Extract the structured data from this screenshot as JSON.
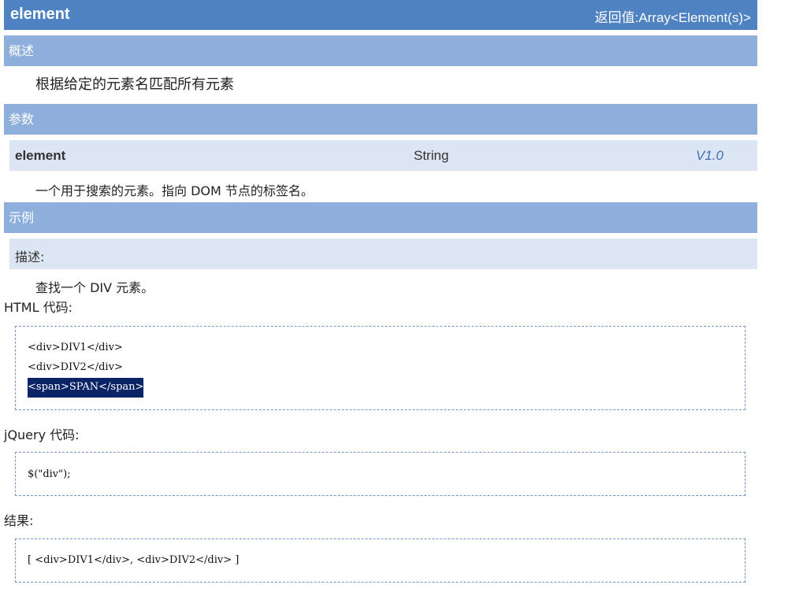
{
  "header": {
    "name": "element",
    "return_value": "返回值:Array<Element(s)>"
  },
  "overview": {
    "heading": "概述",
    "text": "根据给定的元素名匹配所有元素"
  },
  "params": {
    "heading": "参数",
    "name": "element",
    "type": "String",
    "version": "V1.0",
    "description": "一个用于搜索的元素。指向 DOM 节点的标签名。"
  },
  "example": {
    "heading": "示例",
    "desc_label": "描述:",
    "desc_text": "查找一个 DIV 元素。",
    "html_label": "HTML 代码:",
    "html_code": [
      "<div>DIV1</div>",
      "<div>DIV2</div>",
      "<span>SPAN</span>"
    ],
    "jquery_label": "jQuery 代码:",
    "jquery_code": "$(\"div\");",
    "result_label": "结果:",
    "result_code": "[ <div>DIV1</div>, <div>DIV2</div> ]"
  },
  "colors": {
    "title_bar": "#4e82c0",
    "section_header": "#8eaedb",
    "sub_row": "#dbe5f3",
    "selection": "#0a2466",
    "version_text": "#3f6fb5"
  }
}
